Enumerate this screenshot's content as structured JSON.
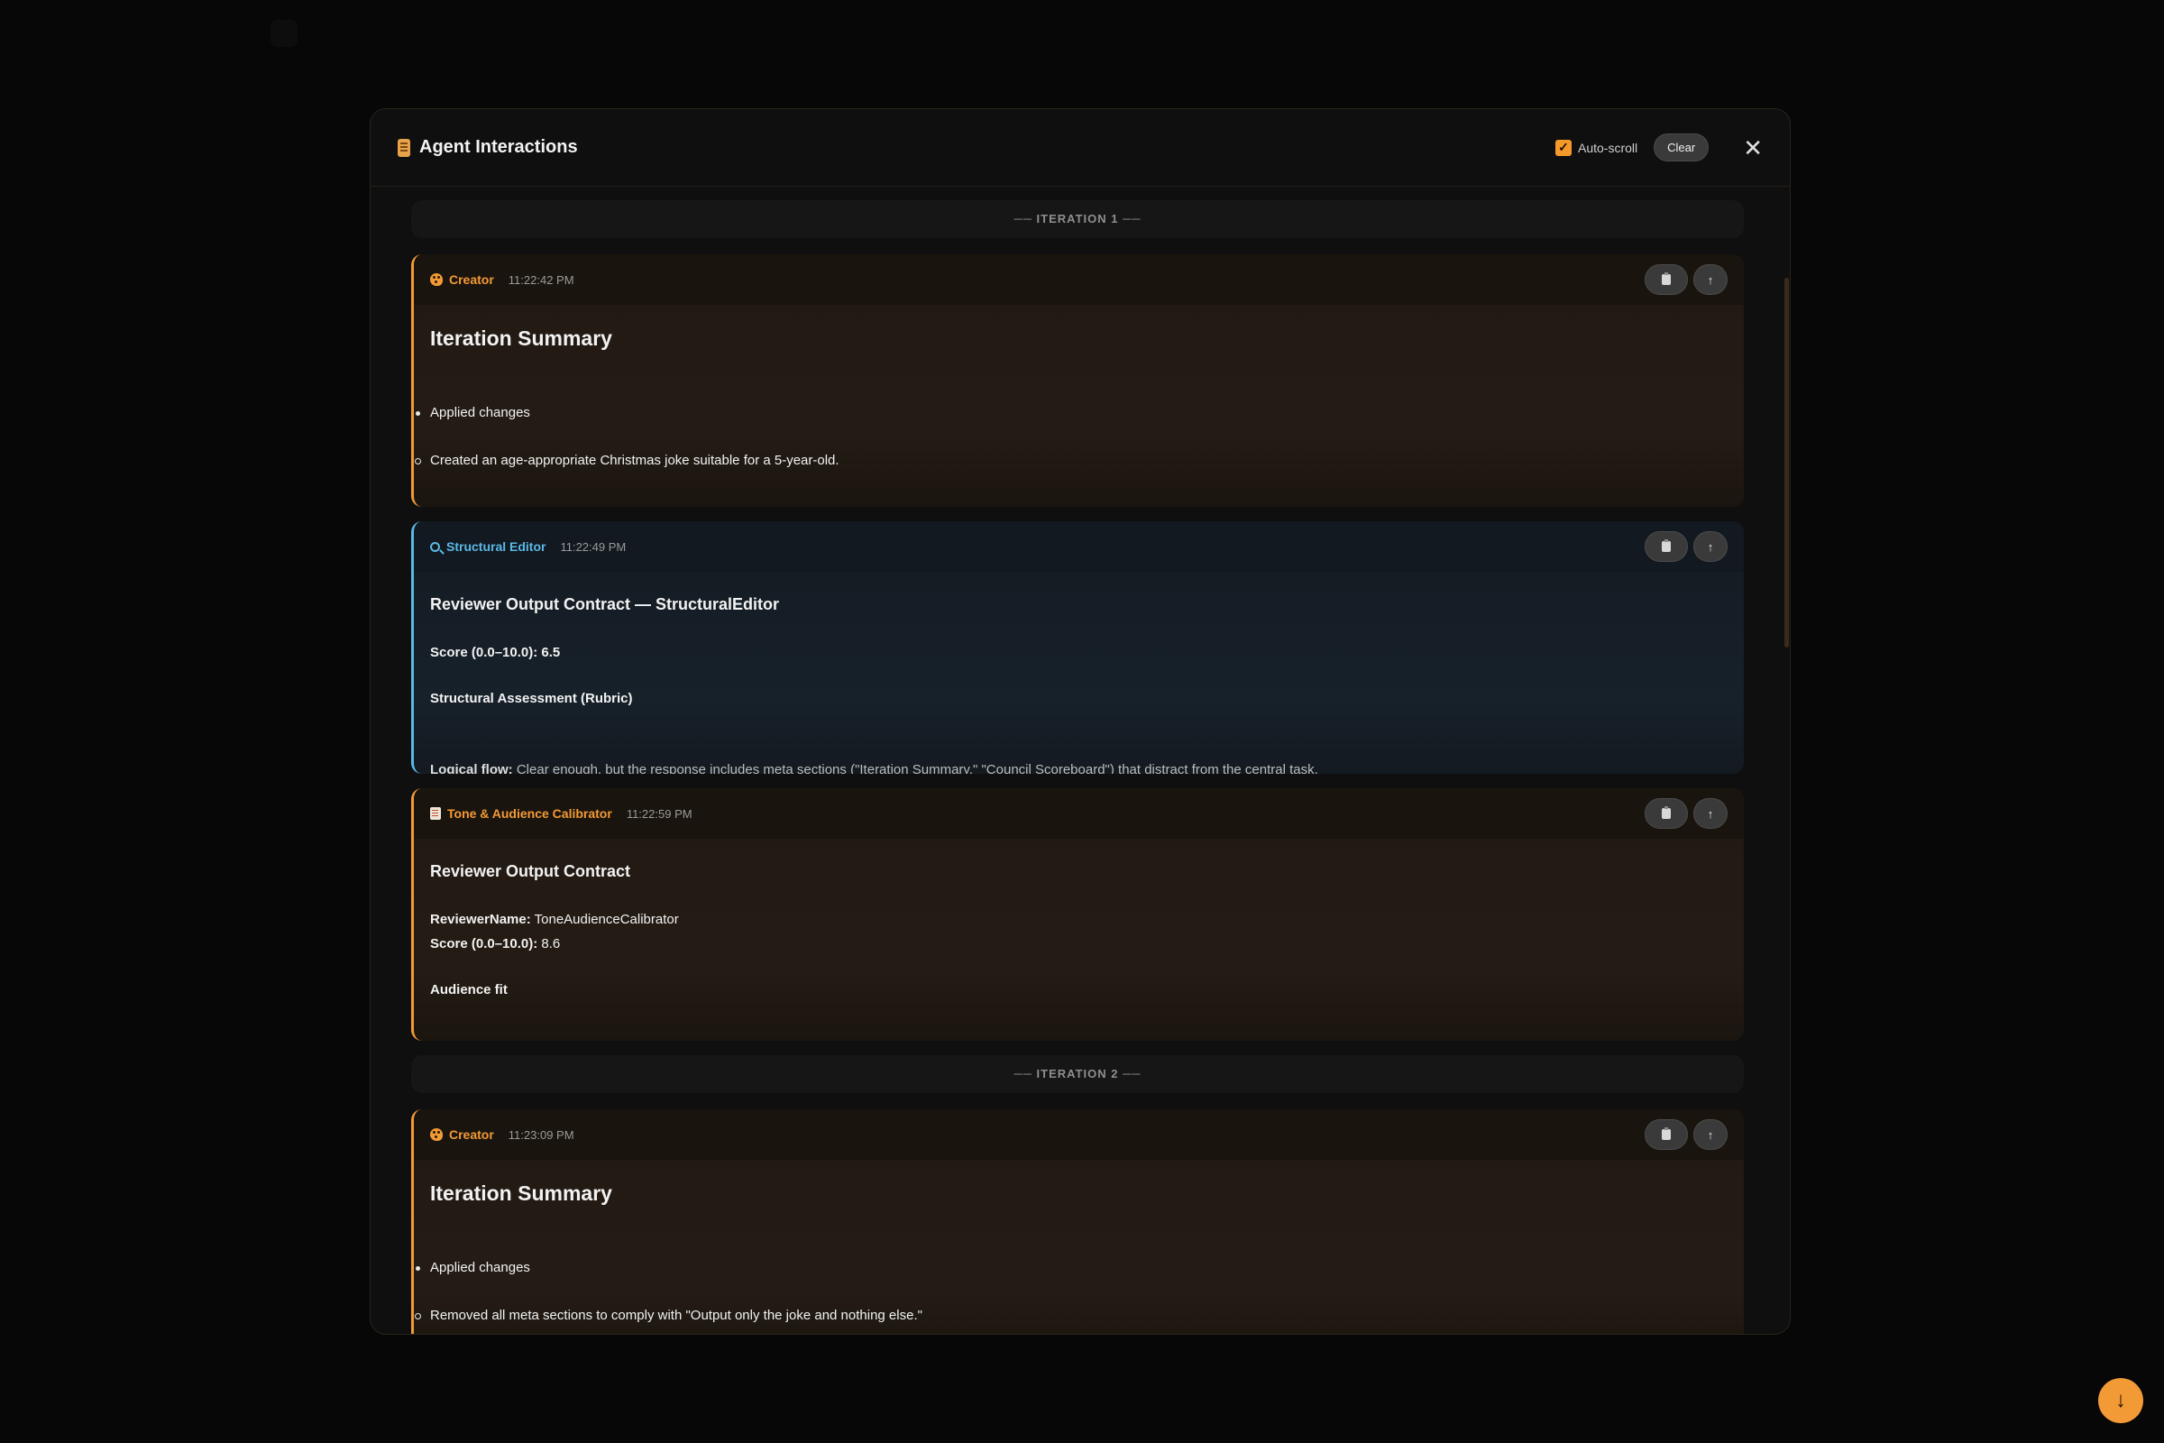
{
  "modal": {
    "title": "Agent Interactions",
    "autoscroll_label": "Auto-scroll",
    "autoscroll_checked": true,
    "clear_label": "Clear",
    "close_glyph": "✕"
  },
  "iterations": [
    {
      "label": "── ITERATION 1 ──"
    },
    {
      "label": "── ITERATION 2 ──"
    }
  ],
  "messages": [
    {
      "agent": "Creator",
      "icon": "palette-icon",
      "accent": "#f29a36",
      "time": "11:22:42 PM",
      "heading": "Iteration Summary",
      "bullet1": "Applied changes",
      "bullet2": "Created an age-appropriate Christmas joke suitable for a 5-year-old."
    },
    {
      "agent": "Structural Editor",
      "icon": "magnifier-icon",
      "accent": "#5bb8e6",
      "time": "11:22:49 PM",
      "heading": "Reviewer Output Contract — StructuralEditor",
      "score_label": "Score (0.0–10.0):",
      "score_value": "6.5",
      "section": "Structural Assessment (Rubric)",
      "cut_label": "Logical flow:",
      "cut_text": "Clear enough, but the response includes meta sections (\"Iteration Summary,\" \"Council Scoreboard\") that distract from the central task."
    },
    {
      "agent": "Tone & Audience Calibrator",
      "icon": "memo-icon",
      "accent": "#f29a36",
      "time": "11:22:59 PM",
      "heading": "Reviewer Output Contract",
      "name_label": "ReviewerName:",
      "name_value": "ToneAudienceCalibrator",
      "score_label": "Score (0.0–10.0):",
      "score_value": "8.6",
      "section": "Audience fit"
    },
    {
      "agent": "Creator",
      "icon": "palette-icon",
      "accent": "#f29a36",
      "time": "11:23:09 PM",
      "heading": "Iteration Summary",
      "bullet1": "Applied changes",
      "bullet2": "Removed all meta sections to comply with \"Output only the joke and nothing else.\""
    }
  ],
  "fab_glyph": "↓"
}
